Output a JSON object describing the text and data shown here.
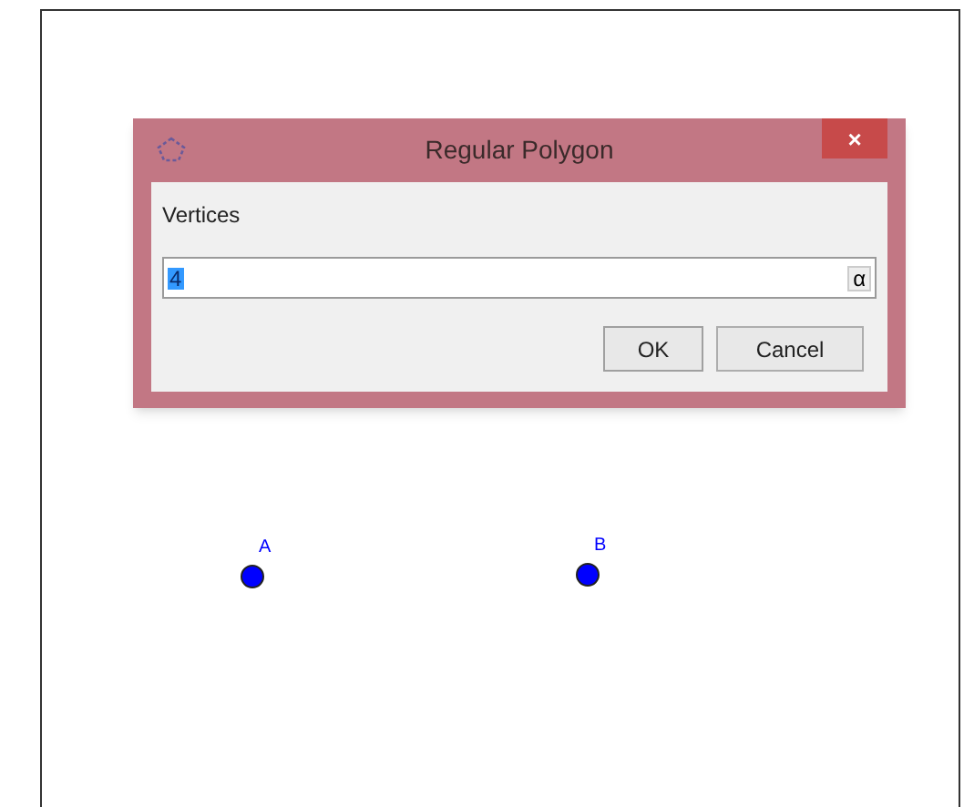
{
  "dialog": {
    "title": "Regular Polygon",
    "close": "×",
    "label": "Vertices",
    "input": {
      "value": "4",
      "value_selected": true,
      "symbol_button": "α"
    },
    "buttons": [
      {
        "label": "OK",
        "kind": "default"
      },
      {
        "label": "Cancel",
        "kind": "normal"
      }
    ]
  },
  "points": [
    {
      "label": "A",
      "color": "#0000ff"
    },
    {
      "label": "B",
      "color": "#0000ff"
    }
  ]
}
